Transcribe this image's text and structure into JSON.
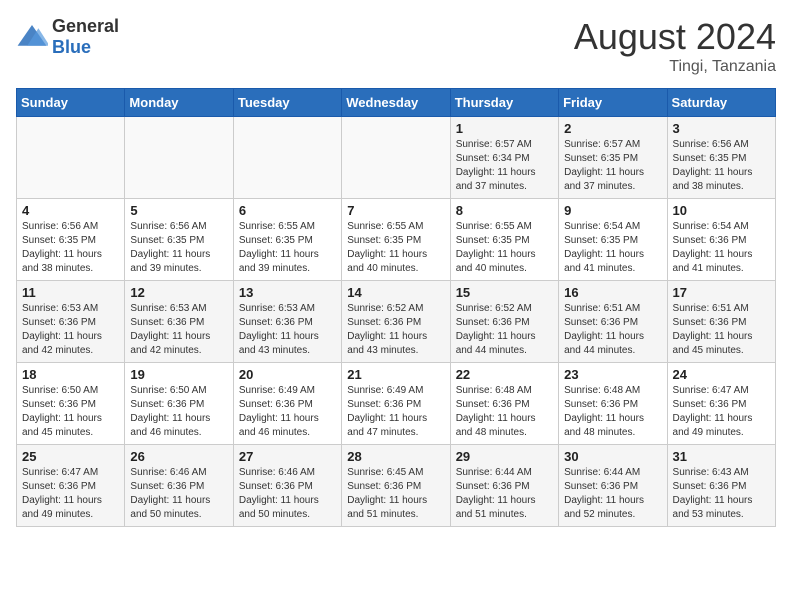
{
  "logo": {
    "general": "General",
    "blue": "Blue"
  },
  "header": {
    "month_year": "August 2024",
    "location": "Tingi, Tanzania"
  },
  "weekdays": [
    "Sunday",
    "Monday",
    "Tuesday",
    "Wednesday",
    "Thursday",
    "Friday",
    "Saturday"
  ],
  "weeks": [
    [
      {
        "day": "",
        "info": ""
      },
      {
        "day": "",
        "info": ""
      },
      {
        "day": "",
        "info": ""
      },
      {
        "day": "",
        "info": ""
      },
      {
        "day": "1",
        "info": "Sunrise: 6:57 AM\nSunset: 6:34 PM\nDaylight: 11 hours and 37 minutes."
      },
      {
        "day": "2",
        "info": "Sunrise: 6:57 AM\nSunset: 6:35 PM\nDaylight: 11 hours and 37 minutes."
      },
      {
        "day": "3",
        "info": "Sunrise: 6:56 AM\nSunset: 6:35 PM\nDaylight: 11 hours and 38 minutes."
      }
    ],
    [
      {
        "day": "4",
        "info": "Sunrise: 6:56 AM\nSunset: 6:35 PM\nDaylight: 11 hours and 38 minutes."
      },
      {
        "day": "5",
        "info": "Sunrise: 6:56 AM\nSunset: 6:35 PM\nDaylight: 11 hours and 39 minutes."
      },
      {
        "day": "6",
        "info": "Sunrise: 6:55 AM\nSunset: 6:35 PM\nDaylight: 11 hours and 39 minutes."
      },
      {
        "day": "7",
        "info": "Sunrise: 6:55 AM\nSunset: 6:35 PM\nDaylight: 11 hours and 40 minutes."
      },
      {
        "day": "8",
        "info": "Sunrise: 6:55 AM\nSunset: 6:35 PM\nDaylight: 11 hours and 40 minutes."
      },
      {
        "day": "9",
        "info": "Sunrise: 6:54 AM\nSunset: 6:35 PM\nDaylight: 11 hours and 41 minutes."
      },
      {
        "day": "10",
        "info": "Sunrise: 6:54 AM\nSunset: 6:36 PM\nDaylight: 11 hours and 41 minutes."
      }
    ],
    [
      {
        "day": "11",
        "info": "Sunrise: 6:53 AM\nSunset: 6:36 PM\nDaylight: 11 hours and 42 minutes."
      },
      {
        "day": "12",
        "info": "Sunrise: 6:53 AM\nSunset: 6:36 PM\nDaylight: 11 hours and 42 minutes."
      },
      {
        "day": "13",
        "info": "Sunrise: 6:53 AM\nSunset: 6:36 PM\nDaylight: 11 hours and 43 minutes."
      },
      {
        "day": "14",
        "info": "Sunrise: 6:52 AM\nSunset: 6:36 PM\nDaylight: 11 hours and 43 minutes."
      },
      {
        "day": "15",
        "info": "Sunrise: 6:52 AM\nSunset: 6:36 PM\nDaylight: 11 hours and 44 minutes."
      },
      {
        "day": "16",
        "info": "Sunrise: 6:51 AM\nSunset: 6:36 PM\nDaylight: 11 hours and 44 minutes."
      },
      {
        "day": "17",
        "info": "Sunrise: 6:51 AM\nSunset: 6:36 PM\nDaylight: 11 hours and 45 minutes."
      }
    ],
    [
      {
        "day": "18",
        "info": "Sunrise: 6:50 AM\nSunset: 6:36 PM\nDaylight: 11 hours and 45 minutes."
      },
      {
        "day": "19",
        "info": "Sunrise: 6:50 AM\nSunset: 6:36 PM\nDaylight: 11 hours and 46 minutes."
      },
      {
        "day": "20",
        "info": "Sunrise: 6:49 AM\nSunset: 6:36 PM\nDaylight: 11 hours and 46 minutes."
      },
      {
        "day": "21",
        "info": "Sunrise: 6:49 AM\nSunset: 6:36 PM\nDaylight: 11 hours and 47 minutes."
      },
      {
        "day": "22",
        "info": "Sunrise: 6:48 AM\nSunset: 6:36 PM\nDaylight: 11 hours and 48 minutes."
      },
      {
        "day": "23",
        "info": "Sunrise: 6:48 AM\nSunset: 6:36 PM\nDaylight: 11 hours and 48 minutes."
      },
      {
        "day": "24",
        "info": "Sunrise: 6:47 AM\nSunset: 6:36 PM\nDaylight: 11 hours and 49 minutes."
      }
    ],
    [
      {
        "day": "25",
        "info": "Sunrise: 6:47 AM\nSunset: 6:36 PM\nDaylight: 11 hours and 49 minutes."
      },
      {
        "day": "26",
        "info": "Sunrise: 6:46 AM\nSunset: 6:36 PM\nDaylight: 11 hours and 50 minutes."
      },
      {
        "day": "27",
        "info": "Sunrise: 6:46 AM\nSunset: 6:36 PM\nDaylight: 11 hours and 50 minutes."
      },
      {
        "day": "28",
        "info": "Sunrise: 6:45 AM\nSunset: 6:36 PM\nDaylight: 11 hours and 51 minutes."
      },
      {
        "day": "29",
        "info": "Sunrise: 6:44 AM\nSunset: 6:36 PM\nDaylight: 11 hours and 51 minutes."
      },
      {
        "day": "30",
        "info": "Sunrise: 6:44 AM\nSunset: 6:36 PM\nDaylight: 11 hours and 52 minutes."
      },
      {
        "day": "31",
        "info": "Sunrise: 6:43 AM\nSunset: 6:36 PM\nDaylight: 11 hours and 53 minutes."
      }
    ]
  ]
}
